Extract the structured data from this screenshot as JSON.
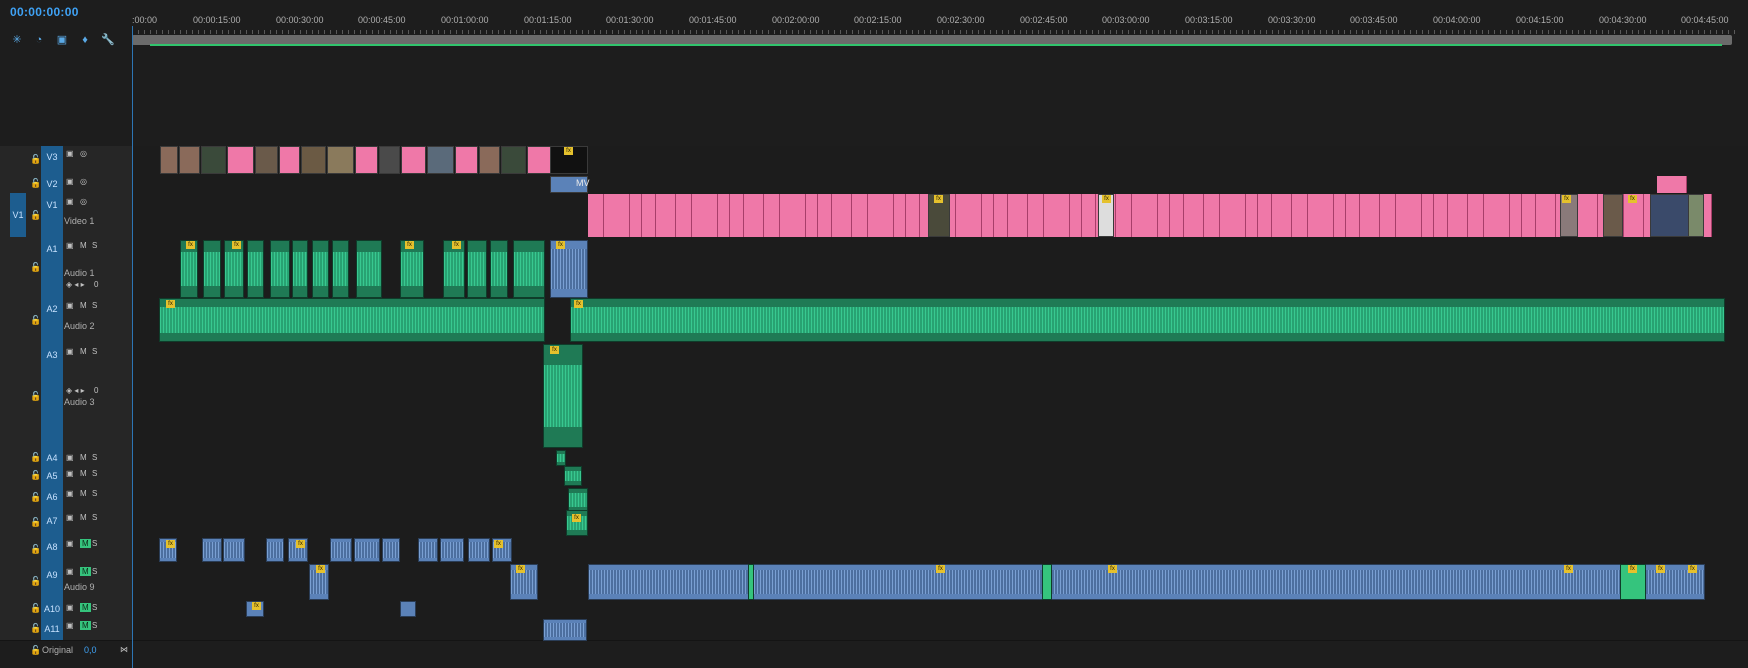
{
  "timecode": "00:00:00:00",
  "tools": [
    {
      "icon": "snap-icon",
      "glyph": "✳"
    },
    {
      "icon": "linked-selection-icon",
      "glyph": "◔"
    },
    {
      "icon": "add-marker-icon",
      "glyph": "▣"
    },
    {
      "icon": "marker-icon",
      "glyph": "♦"
    },
    {
      "icon": "wrench-icon",
      "glyph": "🔧"
    }
  ],
  "ruler_labels": [
    ":00:00",
    "00:00:15:00",
    "00:00:30:00",
    "00:00:45:00",
    "00:01:00:00",
    "00:01:15:00",
    "00:01:30:00",
    "00:01:45:00",
    "00:02:00:00",
    "00:02:15:00",
    "00:02:30:00",
    "00:02:45:00",
    "00:03:00:00",
    "00:03:15:00",
    "00:03:30:00",
    "00:03:45:00",
    "00:04:00:00",
    "00:04:15:00",
    "00:04:30:00",
    "00:04:45:00"
  ],
  "source_patch": "V1",
  "tracks": [
    {
      "id": "V3",
      "label": "",
      "type": "video",
      "toggles": [
        "▣",
        "◎"
      ]
    },
    {
      "id": "V2",
      "label": "",
      "type": "video",
      "toggles": [
        "▣",
        "◎"
      ]
    },
    {
      "id": "V1",
      "label": "Video 1",
      "type": "video",
      "toggles": [
        "▣",
        "◎"
      ]
    },
    {
      "id": "A1",
      "label": "Audio 1",
      "type": "audio",
      "toggles": [
        "▣",
        "M",
        "S"
      ],
      "volume": "0"
    },
    {
      "id": "A2",
      "label": "Audio 2",
      "type": "audio",
      "toggles": [
        "▣",
        "M",
        "S"
      ]
    },
    {
      "id": "A3",
      "label": "Audio 3",
      "type": "audio",
      "toggles": [
        "▣",
        "M",
        "S"
      ],
      "volume": "0"
    },
    {
      "id": "A4",
      "label": "",
      "type": "audio",
      "toggles": [
        "▣",
        "M",
        "S"
      ]
    },
    {
      "id": "A5",
      "label": "",
      "type": "audio",
      "toggles": [
        "▣",
        "M",
        "S"
      ]
    },
    {
      "id": "A6",
      "label": "",
      "type": "audio",
      "toggles": [
        "▣",
        "M",
        "S"
      ]
    },
    {
      "id": "A7",
      "label": "",
      "type": "audio",
      "toggles": [
        "▣",
        "M",
        "S"
      ]
    },
    {
      "id": "A8",
      "label": "",
      "type": "audio",
      "toggles": [
        "▣",
        "M",
        "S"
      ],
      "mute_on": true
    },
    {
      "id": "A9",
      "label": "Audio 9",
      "type": "audio",
      "toggles": [
        "▣",
        "M",
        "S"
      ],
      "mute_on": true
    },
    {
      "id": "A10",
      "label": "",
      "type": "audio",
      "toggles": [
        "▣",
        "M",
        "S"
      ],
      "mute_on": true
    },
    {
      "id": "A11",
      "label": "",
      "type": "audio",
      "toggles": [
        "▣",
        "M",
        "S"
      ],
      "mute_on": true
    }
  ],
  "original": {
    "label": "Original",
    "value": "0,0"
  },
  "clip_labels": {
    "mv": "MV",
    "fx": "fx"
  },
  "colors": {
    "accent": "#3fa2f5",
    "track_target": "#1d5d8f",
    "video_clip": "#ef78a8",
    "audio_clip_green": "#1f7a55",
    "audio_wave_green": "#3dd69b",
    "audio_clip_blue": "#5b82b8",
    "fx_badge": "#e5c12d",
    "mute_active": "#35c47d"
  }
}
